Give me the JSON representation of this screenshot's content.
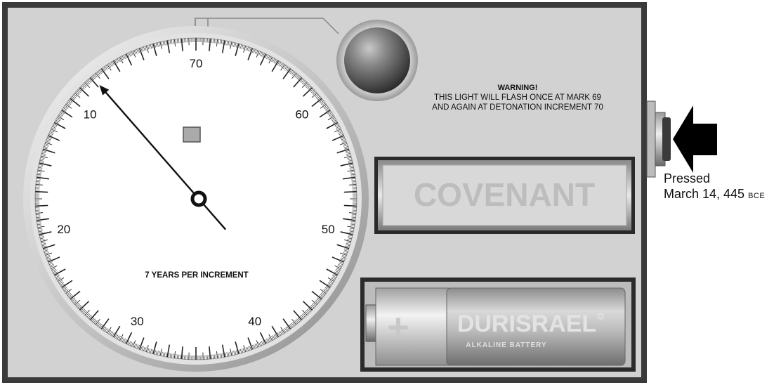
{
  "dial": {
    "major_labels": [
      "70",
      "60",
      "50",
      "40",
      "30",
      "20",
      "10"
    ],
    "caption": "7 YEARS PER INCREMENT",
    "needle_reading": 8
  },
  "warning": {
    "title": "WARNING!",
    "line1": "THIS LIGHT WILL FLASH ONCE AT MARK 69",
    "line2": "AND AGAIN AT DETONATION INCREMENT 70"
  },
  "nameplate": {
    "text": "COVENANT"
  },
  "battery": {
    "plus": "+",
    "brand": "DURISRAEL",
    "star": "✡",
    "subtitle": "ALKALINE BATTERY"
  },
  "button": {
    "pressed_label": "Pressed",
    "date": "March 14, 445",
    "era": "BCE"
  },
  "colors": {
    "panel": "#d2d2d2",
    "frame": "#3a3a3a",
    "nameplate_text": "#bdbdbd",
    "arrow": "#000000"
  }
}
